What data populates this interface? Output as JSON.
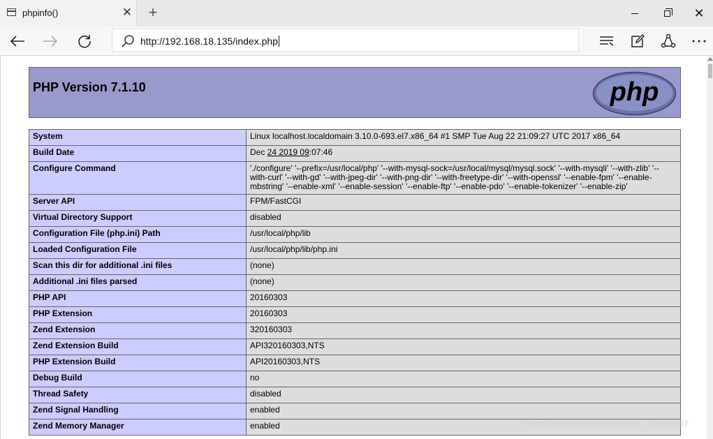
{
  "browser": {
    "tab_title": "phpinfo()",
    "tab_close": "✕",
    "new_tab": "+",
    "win_close": "✕",
    "address": "http://192.168.18.135/index.php"
  },
  "page": {
    "version_title": "PHP Version 7.1.10",
    "logo_text": "php",
    "rows": [
      {
        "key": "System",
        "value": "Linux localhost.localdomain 3.10.0-693.el7.x86_64 #1 SMP Tue Aug 22 21:09:27 UTC 2017 x86_64"
      },
      {
        "key": "Build Date",
        "value_pre": "Dec ",
        "value_underlined": "24 2019 09",
        "value_post": ":07:46"
      },
      {
        "key": "Configure Command",
        "value": "'./configure' '--prefix=/usr/local/php' '--with-mysql-sock=/usr/local/mysql/mysql.sock' '--with-mysqli' '--with-zlib' '--with-curl' '--with-gd' '--with-jpeg-dir' '--with-png-dir' '--with-freetype-dir' '--with-openssl' '--enable-fpm' '--enable-mbstring' '--enable-xml' '--enable-session' '--enable-ftp' '--enable-pdo' '--enable-tokenizer' '--enable-zip'"
      },
      {
        "key": "Server API",
        "value": "FPM/FastCGI"
      },
      {
        "key": "Virtual Directory Support",
        "value": "disabled"
      },
      {
        "key": "Configuration File (php.ini) Path",
        "value": "/usr/local/php/lib"
      },
      {
        "key": "Loaded Configuration File",
        "value": "/usr/local/php/lib/php.ini"
      },
      {
        "key": "Scan this dir for additional .ini files",
        "value": "(none)"
      },
      {
        "key": "Additional .ini files parsed",
        "value": "(none)"
      },
      {
        "key": "PHP API",
        "value": "20160303"
      },
      {
        "key": "PHP Extension",
        "value": "20160303"
      },
      {
        "key": "Zend Extension",
        "value": "320160303"
      },
      {
        "key": "Zend Extension Build",
        "value": "API320160303,NTS"
      },
      {
        "key": "PHP Extension Build",
        "value": "API20160303,NTS"
      },
      {
        "key": "Debug Build",
        "value": "no"
      },
      {
        "key": "Thread Safety",
        "value": "disabled"
      },
      {
        "key": "Zend Signal Handling",
        "value": "enabled"
      },
      {
        "key": "Zend Memory Manager",
        "value": "enabled"
      }
    ],
    "watermark": "https://blog.csdn.net/sinat_31884967"
  }
}
